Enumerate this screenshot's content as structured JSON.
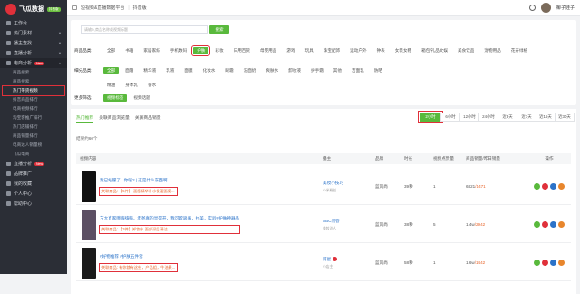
{
  "sidebar": {
    "brand": "飞瓜数据",
    "brand_badge": "抖音版",
    "items": [
      {
        "label": "工作台"
      },
      {
        "label": "热门素材"
      },
      {
        "label": "播主查找"
      },
      {
        "label": "直播分析"
      },
      {
        "label": "电商分析",
        "badge": "New"
      }
    ],
    "sub_items": [
      {
        "label": "商品搜索"
      },
      {
        "label": "商品搜索"
      },
      {
        "label": "热门带货视频"
      },
      {
        "label": "抖音商品排行"
      },
      {
        "label": "电商视频排行"
      },
      {
        "label": "淘宝客推广排行"
      },
      {
        "label": "热门店铺排行"
      },
      {
        "label": "商品销量排行"
      },
      {
        "label": "电商达人销量榜"
      },
      {
        "label": "飞瓜电商"
      }
    ],
    "bottom_items": [
      {
        "label": "直播分析",
        "badge": "New"
      },
      {
        "label": "品牌推广"
      },
      {
        "label": "我的收藏"
      },
      {
        "label": "个人中心"
      },
      {
        "label": "帮助中心"
      }
    ]
  },
  "topbar": {
    "title": "短视频&直播数据平台",
    "platform": "抖音版",
    "user": "椰子娃子"
  },
  "search": {
    "placeholder": "请输入商品名称或视频标题",
    "button": "搜索"
  },
  "filters": {
    "category_label": "商品品类:",
    "categories": [
      "全部",
      "书籍",
      "家居家纺",
      "手机数码",
      "护肤",
      "彩妆",
      "日用百货",
      "母婴用品",
      "游戏",
      "玩具",
      "珠宝配饰",
      "运动户外",
      "钟表",
      "女装女鞋",
      "箱包/礼品文娱",
      "美食饮品",
      "宠物用品",
      "花卉绿植"
    ],
    "sub_label": "细分品类:",
    "sub_categories": [
      "全部",
      "面霜",
      "精华液",
      "乳液",
      "面膜",
      "化妆水",
      "眼霜",
      "洗面奶",
      "爽肤水",
      "卸妆液",
      "护手霜",
      "其他",
      "洁面乳",
      "防晒",
      "精油",
      "身体乳",
      "香水"
    ],
    "more_label": "更多筛选:",
    "more_options": [
      "视频标签",
      "视频话题"
    ],
    "selected_category": "护肤"
  },
  "results": {
    "tabs": [
      "热门推荐",
      "关联商品浏览量",
      "关联商品销量"
    ],
    "periods": [
      "2小时",
      "6小时",
      "12小时",
      "24小时",
      "近3天",
      "近7天",
      "近15天",
      "近30天"
    ],
    "active_period": "2小时",
    "count_text": "结果约60个",
    "columns": {
      "video": "视频内容",
      "blogger": "播主",
      "brand": "品牌",
      "duration": "时长",
      "likes": "视频点赞量",
      "sales": "商品销量/昨日销量",
      "ops": "操作"
    },
    "rows": [
      {
        "title": "我已经服了...你呢? | 这是什么东西啊",
        "goods_label": "关联商品:",
        "goods": "【5片】 面膜精华补水保湿面膜...",
        "blogger": "美妆小技巧",
        "blogger_sub": "小米粉丝",
        "brand": "蓝风尚",
        "duration": "39秒",
        "likes": "1",
        "sales": "6821",
        "sales_y": "1471"
      },
      {
        "title": "方大直家哦嗨嗨嗨，老爸真的显得开，我可欺吸器，拉美，实验#护肤神器品",
        "goods_label": "关联商品:",
        "goods": "【3件】卸妆水 面部深层清洁...",
        "blogger": "ABC问答",
        "blogger_sub": "美妆达人",
        "brand": "蓝风尚",
        "duration": "38秒",
        "likes": "5",
        "sales": "1.4w",
        "sales_y": "2942"
      },
      {
        "title": "#好物推荐 #护肤五件套",
        "goods_label": "关联商品:",
        "goods": "有你就有这些，产品组，牛油果...",
        "blogger": "阿星",
        "blogger_sub": "小店主",
        "brand": "蓝风尚",
        "duration": "58秒",
        "likes": "1",
        "sales": "1.6w",
        "sales_y": "1442"
      }
    ]
  }
}
